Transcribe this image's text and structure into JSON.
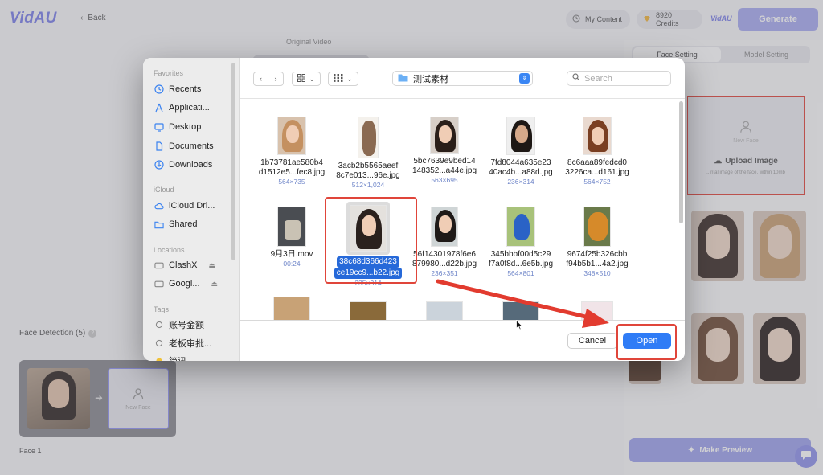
{
  "app": {
    "logo": "VidAU",
    "back_label": "Back",
    "my_content": "My Content",
    "credits": "8920 Credits",
    "brand_small": "VidAU",
    "generate_label": "Generate",
    "original_video_label": "Original Video",
    "face_detection_label": "Face Detection (5)",
    "new_face_label": "New Face",
    "face_1_label": "Face 1",
    "accent_color": "#7b7fe8"
  },
  "right_panel": {
    "tabs": [
      {
        "label": "Face Setting",
        "active": true
      },
      {
        "label": "Model Setting",
        "active": false
      }
    ],
    "upload_new_face": "New Face",
    "upload_label": "Upload Image",
    "upload_hint": "...ntal image of the face, within 10mb",
    "make_preview_label": "Make Preview"
  },
  "dialog": {
    "sidebar": {
      "sections": [
        {
          "heading": "Favorites",
          "items": [
            {
              "label": "Recents",
              "icon": "clock-icon"
            },
            {
              "label": "Applicati...",
              "icon": "applications-icon"
            },
            {
              "label": "Desktop",
              "icon": "desktop-icon"
            },
            {
              "label": "Documents",
              "icon": "document-icon"
            },
            {
              "label": "Downloads",
              "icon": "download-icon"
            }
          ]
        },
        {
          "heading": "iCloud",
          "items": [
            {
              "label": "iCloud Dri...",
              "icon": "cloud-icon"
            },
            {
              "label": "Shared",
              "icon": "shared-folder-icon"
            }
          ]
        },
        {
          "heading": "Locations",
          "items": [
            {
              "label": "ClashX",
              "icon": "drive-icon",
              "eject": true
            },
            {
              "label": "Googl...",
              "icon": "drive-icon",
              "eject": true
            }
          ]
        },
        {
          "heading": "Tags",
          "items": [
            {
              "label": "账号金额",
              "icon": "tag-circle-icon"
            },
            {
              "label": "老板审批...",
              "icon": "tag-circle-icon"
            },
            {
              "label": "简讯",
              "icon": "tag-circle-icon"
            }
          ]
        }
      ]
    },
    "folder_name": "测试素材",
    "search_placeholder": "Search",
    "files": [
      {
        "name1": "1b73781ae580b4",
        "name2": "d1512e5...fec8.jpg",
        "dims": "564×735",
        "selected": false
      },
      {
        "name1": "3acb2b5565aeef",
        "name2": "8c7e013...96e.jpg",
        "dims": "512×1,024",
        "selected": false
      },
      {
        "name1": "5bc7639e9bed14",
        "name2": "148352...a44e.jpg",
        "dims": "563×695",
        "selected": false
      },
      {
        "name1": "7fd8044a635e23",
        "name2": "40ac4b...a88d.jpg",
        "dims": "236×314",
        "selected": false
      },
      {
        "name1": "8c6aaa89fedcd0",
        "name2": "3226ca...d161.jpg",
        "dims": "564×752",
        "selected": false
      },
      {
        "name1": "9月3日.mov",
        "name2": "",
        "dims": "00:24",
        "selected": false
      },
      {
        "name1": "38c68d366d423",
        "name2": "ce19cc9...b22.jpg",
        "dims": "235×314",
        "selected": true
      },
      {
        "name1": "56f14301978f6e6",
        "name2": "879980...d22b.jpg",
        "dims": "236×351",
        "selected": false
      },
      {
        "name1": "345bbbf00d5c29",
        "name2": "f7a0f8d...6e5b.jpg",
        "dims": "564×801",
        "selected": false
      },
      {
        "name1": "9674f25b326cbb",
        "name2": "f94b5b1...4a2.jpg",
        "dims": "348×510",
        "selected": false
      }
    ],
    "cancel_label": "Cancel",
    "open_label": "Open",
    "selection_color": "#2669d9",
    "highlight_color": "#e0453a"
  }
}
